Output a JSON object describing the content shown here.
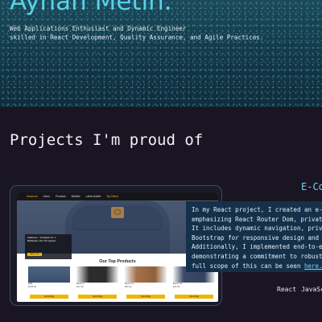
{
  "hero": {
    "name": "Ayhan Metin.",
    "bio_lines": [
      "Web Applications Enthusiast and Dynamic Engineer",
      "skilled in React Development, Quality Assurance, and Agile Practices."
    ]
  },
  "projects": {
    "section_title": "Projects I'm proud of",
    "project": {
      "title": "E-Co",
      "screenshot": {
        "nav": [
          "Amazona",
          "Home",
          "Products",
          "Wishlist",
          "Latest Added",
          "Top Rated"
        ],
        "caption_lines": [
          "Fjallraven - Foldsack No. 1",
          "Backpack, Fits 15 Laptops"
        ],
        "caption_button": "Shop now",
        "products_title": "Our Top Products",
        "products": [
          {
            "name": "Fjall...",
            "price": "$109.95",
            "button": "Add to Bag",
            "color": "#3f5673"
          },
          {
            "name": "Mens C...",
            "price": "$22.30",
            "button": "Add to Bag",
            "color": "#2e2e2e"
          },
          {
            "name": "Mens Co...",
            "price": "$55.99",
            "button": "Add to Bag",
            "color": "#a5714a"
          },
          {
            "name": "Mens Ca...",
            "price": "$15.99",
            "button": "Add to Bag",
            "color": "#3b4b68"
          }
        ]
      },
      "description_lines": [
        "In my React project, I created an e-c",
        "emphasizing React Router Dom, private",
        "It includes dynamic navigation, priva",
        "Bootstrap for responsive design and e",
        "Additionally, I implemented end-to-en",
        "demonstrating a commitment to robust "
      ],
      "description_last_prefix": "full scope of this can be seen ",
      "description_link": "here.",
      "tech": [
        "React",
        "JavaSc"
      ]
    }
  },
  "colors": {
    "accent": "#5ad0e6",
    "page_background": "#1a1523",
    "hero_background": "#123645",
    "card_button": "#f0b400"
  }
}
